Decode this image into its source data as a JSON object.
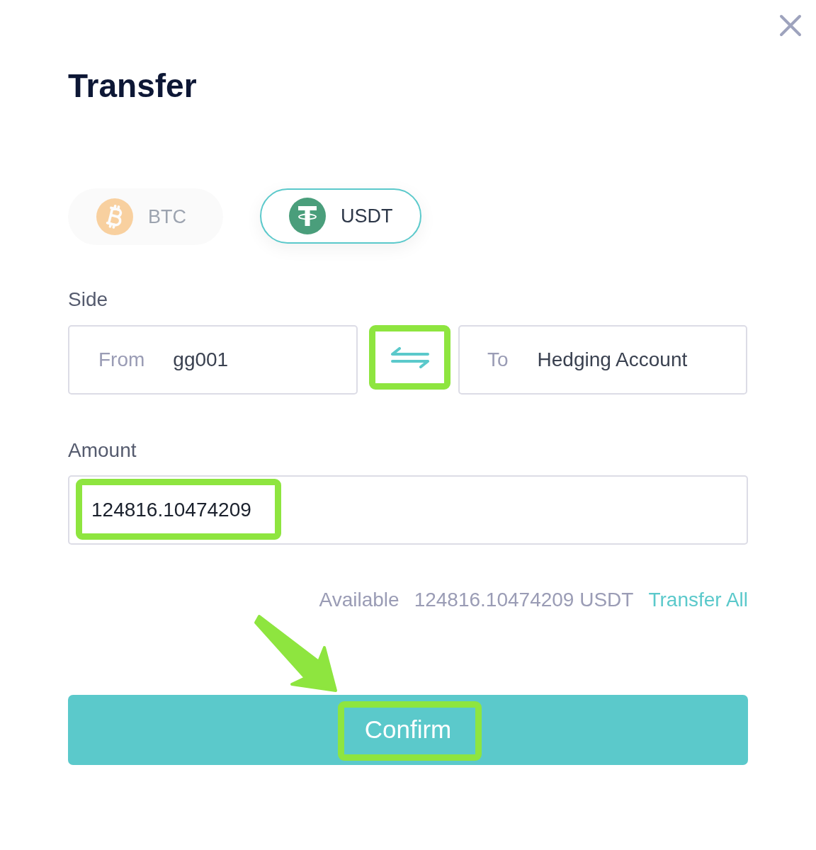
{
  "title": "Transfer",
  "coins": [
    {
      "kind": "bitcoin",
      "label": "BTC",
      "selected": false
    },
    {
      "kind": "tether",
      "label": "USDT",
      "selected": true
    }
  ],
  "side": {
    "label": "Side",
    "from": {
      "label": "From",
      "value": "gg001"
    },
    "swap": {
      "highlighted": true
    },
    "to": {
      "label": "To",
      "value": "Hedging Account"
    }
  },
  "amount": {
    "label": "Amount",
    "value": "124816.10474209",
    "highlighted": true
  },
  "available": {
    "label": "Available",
    "value": "124816.10474209 USDT",
    "link": "Transfer All"
  },
  "confirm_button": {
    "label": "Confirm",
    "highlighted": true,
    "arrow": true
  }
}
